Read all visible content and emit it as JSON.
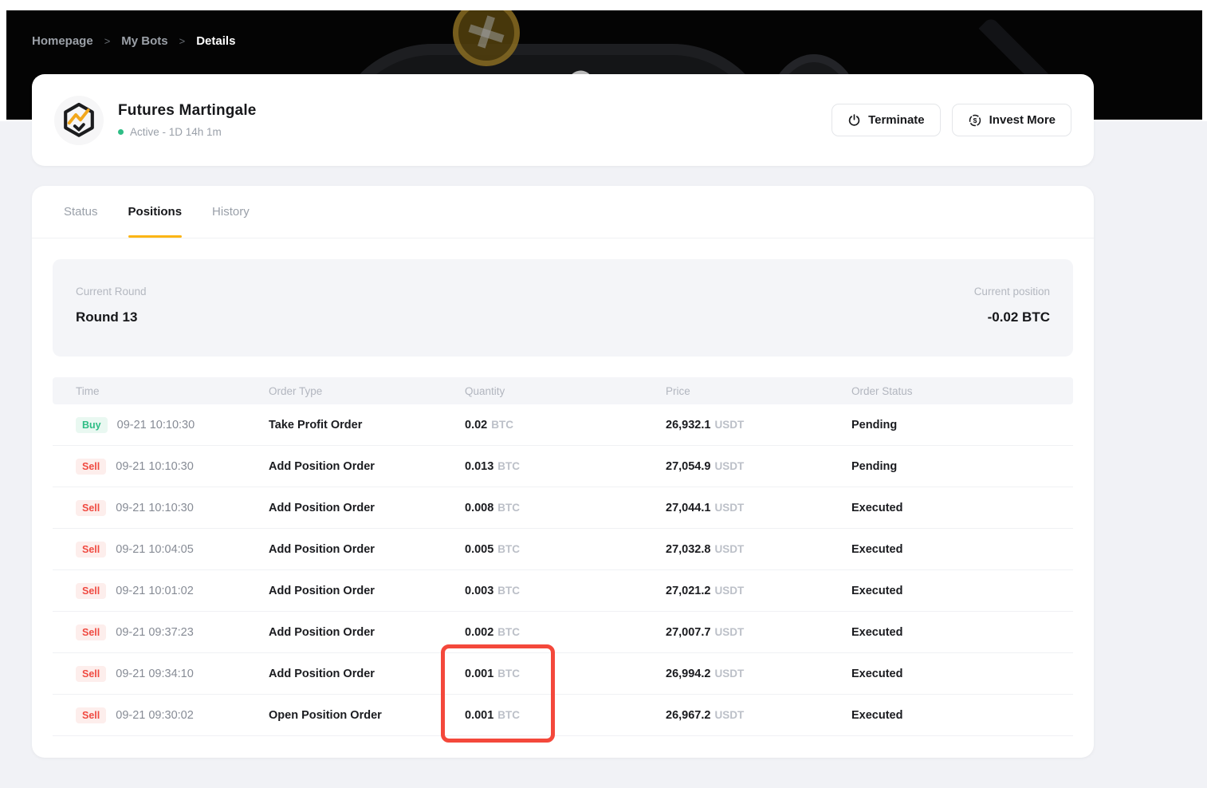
{
  "breadcrumb": {
    "items": [
      {
        "label": "Homepage",
        "current": false
      },
      {
        "label": "My Bots",
        "current": false
      },
      {
        "label": "Details",
        "current": true
      }
    ],
    "separator": ">"
  },
  "bot": {
    "name": "Futures Martingale",
    "status_text": "Active - 1D 14h 1m",
    "status_color": "#2ebd85"
  },
  "actions": {
    "terminate_label": "Terminate",
    "invest_label": "Invest More"
  },
  "tabs": [
    {
      "label": "Status",
      "active": false
    },
    {
      "label": "Positions",
      "active": true
    },
    {
      "label": "History",
      "active": false
    }
  ],
  "summary": {
    "round_label": "Current Round",
    "round_value": "Round 13",
    "position_label": "Current position",
    "position_value": "-0.02 BTC"
  },
  "table": {
    "columns": [
      "Time",
      "Order Type",
      "Quantity",
      "Price",
      "Order Status"
    ],
    "rows": [
      {
        "side": "Buy",
        "time": "09-21 10:10:30",
        "order_type": "Take Profit Order",
        "quantity": "0.02",
        "quantity_unit": "BTC",
        "price": "26,932.1",
        "price_unit": "USDT",
        "status": "Pending",
        "quantity_highlighted": false
      },
      {
        "side": "Sell",
        "time": "09-21 10:10:30",
        "order_type": "Add Position Order",
        "quantity": "0.013",
        "quantity_unit": "BTC",
        "price": "27,054.9",
        "price_unit": "USDT",
        "status": "Pending",
        "quantity_highlighted": false
      },
      {
        "side": "Sell",
        "time": "09-21 10:10:30",
        "order_type": "Add Position Order",
        "quantity": "0.008",
        "quantity_unit": "BTC",
        "price": "27,044.1",
        "price_unit": "USDT",
        "status": "Executed",
        "quantity_highlighted": false
      },
      {
        "side": "Sell",
        "time": "09-21 10:04:05",
        "order_type": "Add Position Order",
        "quantity": "0.005",
        "quantity_unit": "BTC",
        "price": "27,032.8",
        "price_unit": "USDT",
        "status": "Executed",
        "quantity_highlighted": false
      },
      {
        "side": "Sell",
        "time": "09-21 10:01:02",
        "order_type": "Add Position Order",
        "quantity": "0.003",
        "quantity_unit": "BTC",
        "price": "27,021.2",
        "price_unit": "USDT",
        "status": "Executed",
        "quantity_highlighted": false
      },
      {
        "side": "Sell",
        "time": "09-21 09:37:23",
        "order_type": "Add Position Order",
        "quantity": "0.002",
        "quantity_unit": "BTC",
        "price": "27,007.7",
        "price_unit": "USDT",
        "status": "Executed",
        "quantity_highlighted": false
      },
      {
        "side": "Sell",
        "time": "09-21 09:34:10",
        "order_type": "Add Position Order",
        "quantity": "0.001",
        "quantity_unit": "BTC",
        "price": "26,994.2",
        "price_unit": "USDT",
        "status": "Executed",
        "quantity_highlighted": true
      },
      {
        "side": "Sell",
        "time": "09-21 09:30:02",
        "order_type": "Open Position Order",
        "quantity": "0.001",
        "quantity_unit": "BTC",
        "price": "26,967.2",
        "price_unit": "USDT",
        "status": "Executed",
        "quantity_highlighted": true
      }
    ]
  },
  "colors": {
    "buy_green": "#2ebd85",
    "sell_red": "#f04a41",
    "tab_underline_gold": "#fcb515",
    "highlight_box_red": "#f4483b",
    "banner_black": "#040404"
  },
  "icons": {
    "bot_avatar": "hexagon-chart-icon",
    "terminate": "power-icon",
    "invest": "dollar-refresh-icon"
  }
}
